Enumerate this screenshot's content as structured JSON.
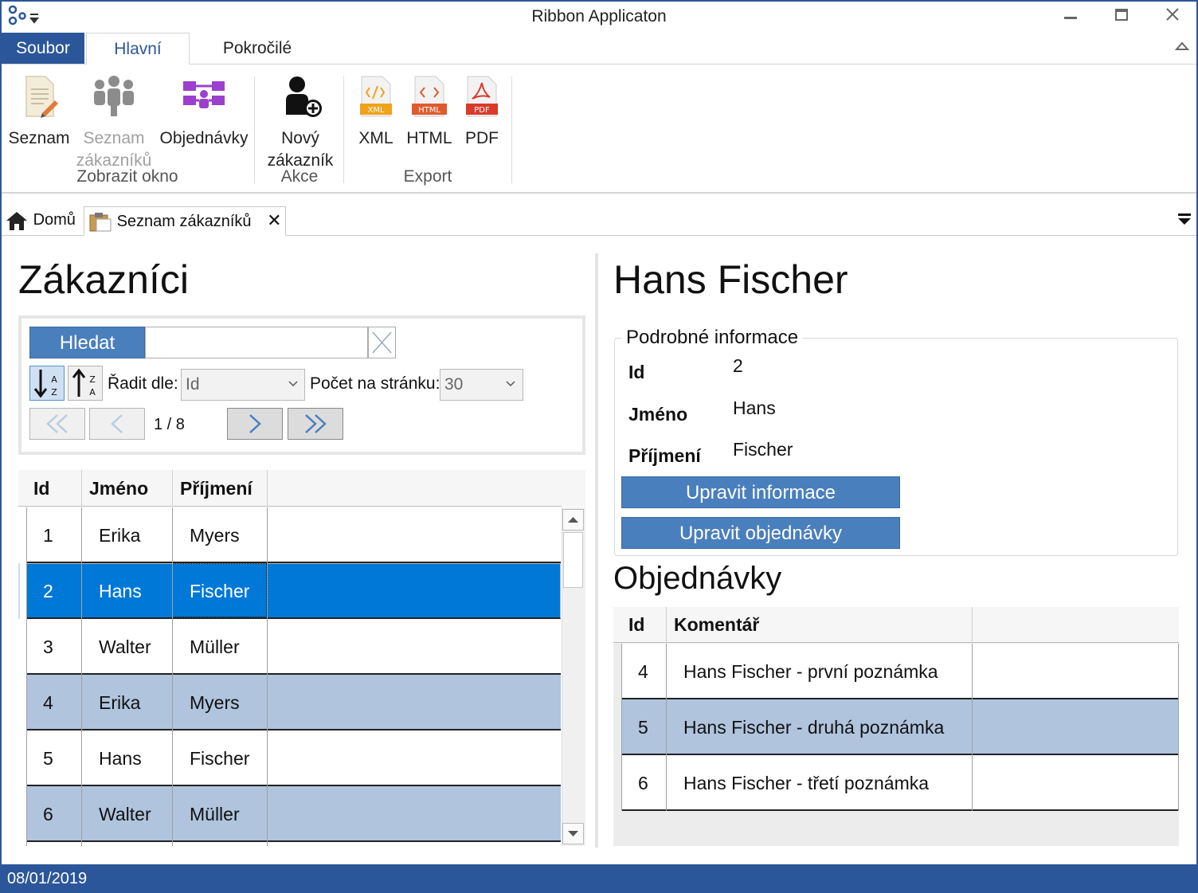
{
  "window": {
    "title": "Ribbon Applicaton"
  },
  "ribbon": {
    "tabs": [
      {
        "label": "Soubor"
      },
      {
        "label": "Hlavní"
      },
      {
        "label": "Pokročilé"
      }
    ],
    "groups": {
      "zobrazit_okno": {
        "label": "Zobrazit okno",
        "buttons": [
          {
            "label": "Seznam",
            "icon": "document-edit-icon",
            "enabled": true
          },
          {
            "label_line1": "Seznam",
            "label_line2": "zákazníků",
            "icon": "people-icon",
            "enabled": false
          },
          {
            "label": "Objednávky",
            "icon": "org-chart-icon",
            "enabled": true
          }
        ]
      },
      "akce": {
        "label": "Akce",
        "buttons": [
          {
            "label_line1": "Nový",
            "label_line2": "zákazník",
            "icon": "add-user-icon",
            "enabled": true
          }
        ]
      },
      "export": {
        "label": "Export",
        "buttons": [
          {
            "label": "XML",
            "badge": "XML",
            "icon": "xml-file-icon"
          },
          {
            "label": "HTML",
            "badge": "HTML",
            "icon": "html-file-icon"
          },
          {
            "label": "PDF",
            "badge": "PDF",
            "icon": "pdf-file-icon"
          }
        ]
      }
    }
  },
  "doc_tabs": [
    {
      "label": "Domů",
      "icon": "home-icon"
    },
    {
      "label": "Seznam zákazníků",
      "icon": "clipboard-icon",
      "close": "✕"
    }
  ],
  "customers": {
    "title": "Zákazníci",
    "search": {
      "button": "Hledat",
      "value": ""
    },
    "sort": {
      "label": "Řadit dle:",
      "value": "Id"
    },
    "page_size": {
      "label": "Počet na stránku:",
      "value": "30"
    },
    "pager": {
      "text": "1 / 8"
    },
    "columns": [
      "Id",
      "Jméno",
      "Příjmení"
    ],
    "rows": [
      {
        "id": "1",
        "first": "Erika",
        "last": "Myers"
      },
      {
        "id": "2",
        "first": "Hans",
        "last": "Fischer"
      },
      {
        "id": "3",
        "first": "Walter",
        "last": "Müller"
      },
      {
        "id": "4",
        "first": "Erika",
        "last": "Myers"
      },
      {
        "id": "5",
        "first": "Hans",
        "last": "Fischer"
      },
      {
        "id": "6",
        "first": "Walter",
        "last": "Müller"
      }
    ]
  },
  "detail": {
    "title": "Hans Fischer",
    "group_label": "Podrobné informace",
    "fields": [
      {
        "label": "Id",
        "value": "2"
      },
      {
        "label": "Jméno",
        "value": "Hans"
      },
      {
        "label": "Příjmení",
        "value": "Fischer"
      }
    ],
    "buttons": {
      "edit_info": "Upravit informace",
      "edit_orders": "Upravit objednávky"
    },
    "orders_title": "Objednávky",
    "orders_columns": [
      "Id",
      "Komentář"
    ],
    "orders": [
      {
        "id": "4",
        "comment": "Hans Fischer - první poznámka"
      },
      {
        "id": "5",
        "comment": "Hans Fischer - druhá poznámka"
      },
      {
        "id": "6",
        "comment": "Hans Fischer - třetí poznámka"
      }
    ]
  },
  "status": {
    "date": "08/01/2019"
  },
  "colors": {
    "accent": "#2b579a",
    "selection": "#0078d7",
    "alt_row": "#b0c4de",
    "button": "#4a7fbd"
  }
}
